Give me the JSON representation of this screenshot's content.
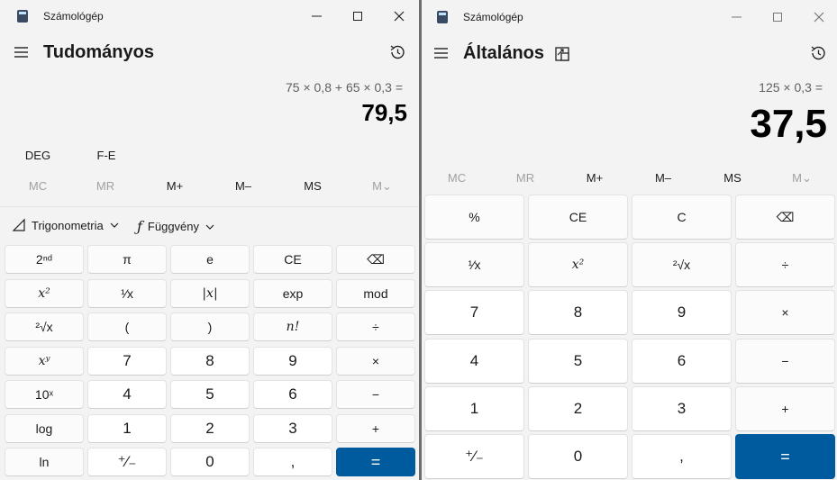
{
  "left": {
    "window_title": "Számológép",
    "mode_title": "Tudományos",
    "expression": "75 × 0,8 + 65 × 0,3 =",
    "result": "79,5",
    "angle_mode": "DEG",
    "fe_label": "F-E",
    "memory": [
      "MC",
      "MR",
      "M+",
      "M–",
      "MS",
      "M⌄"
    ],
    "trig_label": "Trigonometria",
    "func_label": "Függvény",
    "keys": [
      [
        "2ⁿᵈ",
        "π",
        "e",
        "CE",
        "⌫"
      ],
      [
        "x²",
        "¹⁄x",
        "|x|",
        "exp",
        "mod"
      ],
      [
        "²√x",
        "(",
        ")",
        "n!",
        "÷"
      ],
      [
        "xʸ",
        "7",
        "8",
        "9",
        "×"
      ],
      [
        "10ˣ",
        "4",
        "5",
        "6",
        "−"
      ],
      [
        "log",
        "1",
        "2",
        "3",
        "+"
      ],
      [
        "ln",
        "⁺⁄₋",
        "0",
        ",",
        "="
      ]
    ]
  },
  "right": {
    "window_title": "Számológép",
    "mode_title": "Általános",
    "expression": "125 × 0,3 =",
    "result": "37,5",
    "memory": [
      "MC",
      "MR",
      "M+",
      "M–",
      "MS",
      "M⌄"
    ],
    "keys": [
      [
        "%",
        "CE",
        "C",
        "⌫"
      ],
      [
        "¹⁄x",
        "x²",
        "²√x",
        "÷"
      ],
      [
        "7",
        "8",
        "9",
        "×"
      ],
      [
        "4",
        "5",
        "6",
        "−"
      ],
      [
        "1",
        "2",
        "3",
        "+"
      ],
      [
        "⁺⁄₋",
        "0",
        ",",
        "="
      ]
    ]
  },
  "colors": {
    "accent": "#005a9e",
    "background": "#f3f3f3",
    "key": "#fbfbfb",
    "number_key": "#ffffff"
  },
  "icons": [
    "calculator-icon",
    "minimize-icon",
    "maximize-icon",
    "close-icon",
    "hamburger-icon",
    "history-icon",
    "keep-on-top-icon",
    "triangle-icon",
    "function-icon",
    "chevron-down-icon"
  ]
}
